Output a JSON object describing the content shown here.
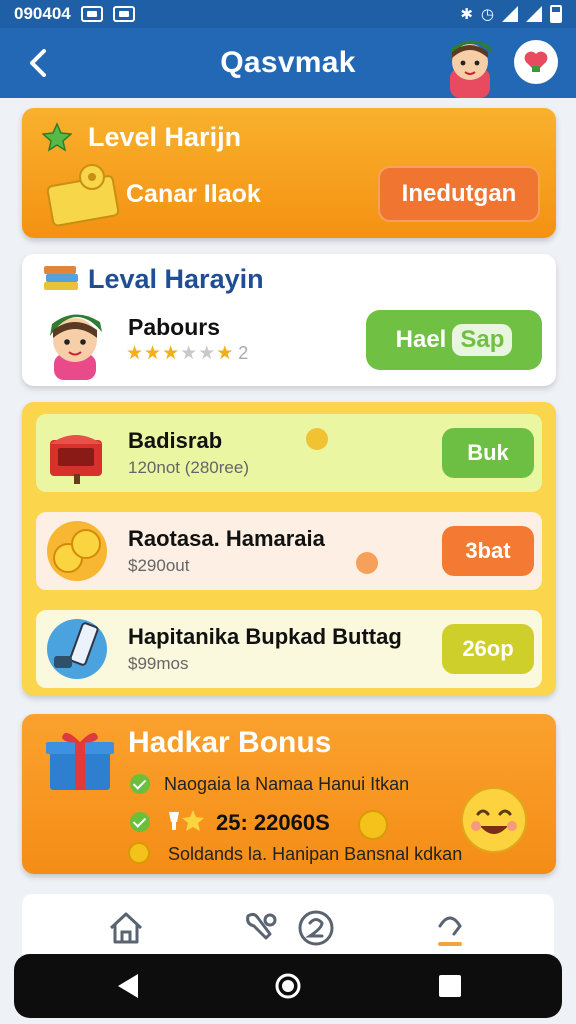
{
  "status_bar": {
    "time": "090404"
  },
  "header": {
    "title": "Qasvmak"
  },
  "level_card": {
    "title": "Level Harijn",
    "subtitle": "Canar Ilaok",
    "button": "Inedutgan"
  },
  "level_card_2": {
    "title": "Leval Harayin",
    "name": "Pabours",
    "rating": 3,
    "rating_count": "2",
    "button_main": "Hael",
    "button_highlight": "Sap"
  },
  "shop": {
    "items": [
      {
        "title": "Badisrab",
        "subtitle": "120not (280ree)",
        "button": "Buk"
      },
      {
        "title": "Raotasa. Hamaraia",
        "subtitle": "$290out",
        "button": "3bat"
      },
      {
        "title": "Hapitanika Bupkad Buttag",
        "subtitle": "$99mos",
        "button": "26op"
      }
    ]
  },
  "bonus": {
    "title": "Hadkar Bonus",
    "line1": "Naogaia la Namaa Hanui Itkan",
    "line2": "25: 22060S",
    "line3": "Soldands la. Hanipan Bansnal kdkan"
  },
  "colors": {
    "header": "#2368b4",
    "orange": "#f49112",
    "green": "#6fc043",
    "yellow": "#fbd54b"
  }
}
